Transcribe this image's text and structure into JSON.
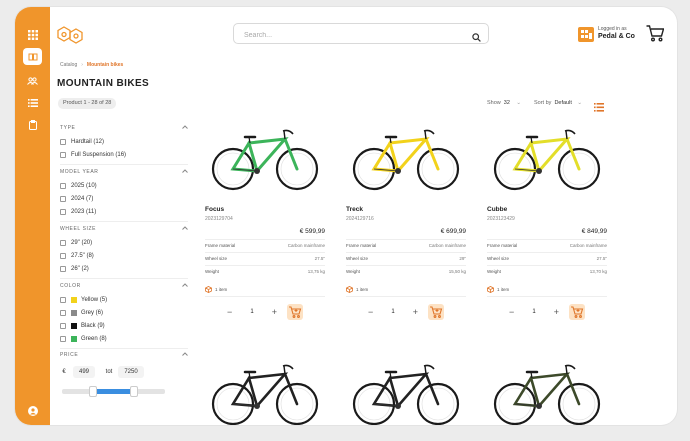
{
  "header": {
    "search_placeholder": "Search...",
    "account_line1": "Logged in as",
    "account_name": "Pedal & Co"
  },
  "breadcrumb": {
    "root": "Catalog",
    "current": "Mountain bikes"
  },
  "page_title": "MOUNTAIN BIKES",
  "product_count": "Product 1 - 28 of 28",
  "controls": {
    "show_label": "Show",
    "show_value": "32",
    "sort_label": "Sort by",
    "sort_value": "Default"
  },
  "filters": {
    "type": {
      "title": "TYPE",
      "options": [
        "Hardtail (12)",
        "Full Suspension (16)"
      ]
    },
    "model_year": {
      "title": "MODEL YEAR",
      "options": [
        "2025 (10)",
        "2024 (7)",
        "2023 (11)"
      ]
    },
    "wheel_size": {
      "title": "WHEEL SIZE",
      "options": [
        "29\" (20)",
        "27.5\" (8)",
        "26\" (2)"
      ]
    },
    "color": {
      "title": "COLOR",
      "options": [
        "Yellow (5)",
        "Grey (6)",
        "Black (9)",
        "Green (8)"
      ],
      "swatches": [
        "#f2d21b",
        "#8a8a8a",
        "#111111",
        "#3cb45a"
      ]
    },
    "price": {
      "title": "PRICE",
      "currency": "€",
      "min": "499",
      "to": "tot",
      "max": "7250"
    }
  },
  "spec_labels": {
    "frame": "Frame material",
    "wheel": "Wheel size",
    "weight": "Weight"
  },
  "products": [
    {
      "name": "Focus",
      "sku": "2023129704",
      "price": "€ 599,99",
      "frame": "Carbon mainframe",
      "wheel": "27.5\"",
      "weight": "13,75 kg",
      "stock": "1 item",
      "qty": "1",
      "color": "#3cb45a"
    },
    {
      "name": "Treck",
      "sku": "2024129716",
      "price": "€ 699,99",
      "frame": "Carbon mainframe",
      "wheel": "29\"",
      "weight": "15,50 kg",
      "stock": "1 item",
      "qty": "1",
      "color": "#f2d21b"
    },
    {
      "name": "Cubbe",
      "sku": "2023123429",
      "price": "€ 849,99",
      "frame": "Carbon mainframe",
      "wheel": "27.5\"",
      "weight": "13,70 kg",
      "stock": "1 item",
      "qty": "1",
      "color": "#e3de2a"
    }
  ],
  "accent": "#f0952b"
}
